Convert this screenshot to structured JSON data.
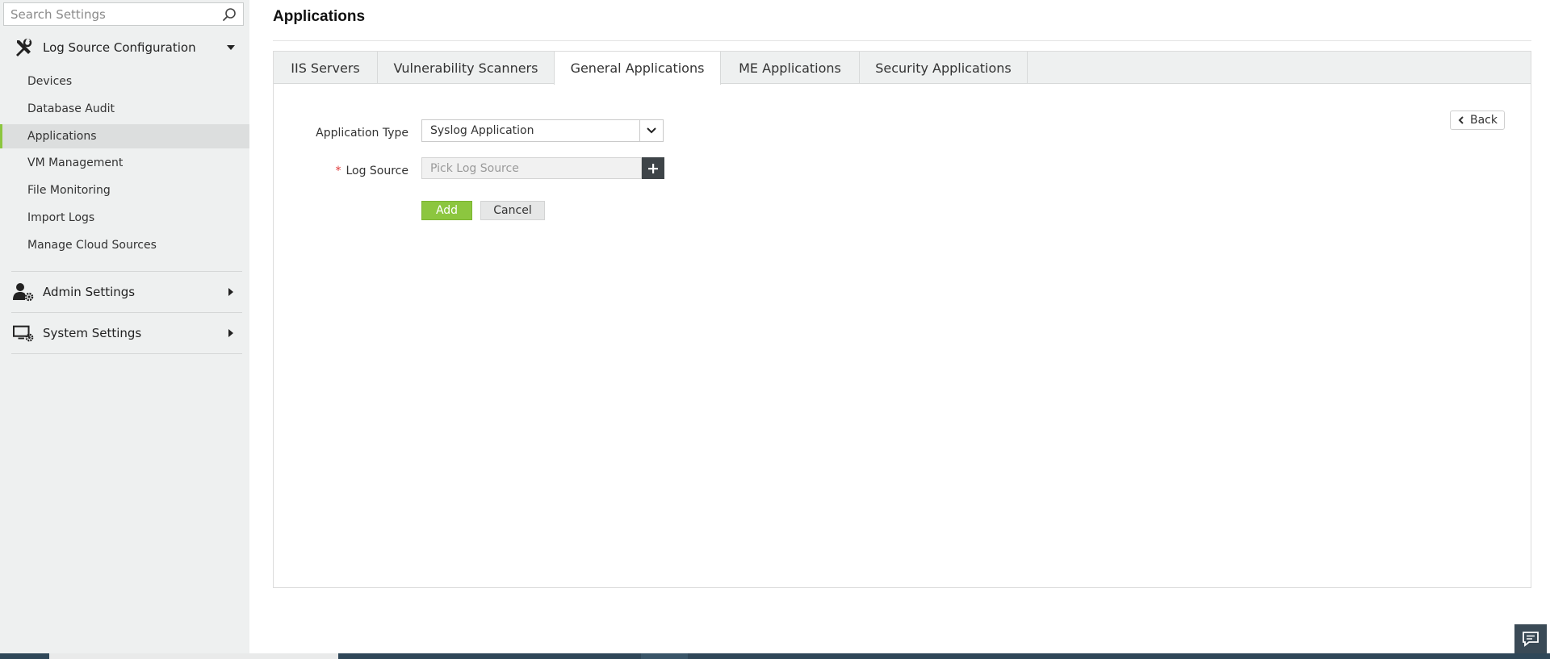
{
  "search": {
    "placeholder": "Search Settings",
    "icon": "search-icon"
  },
  "sidebar": {
    "sections": [
      {
        "label": "Log Source Configuration",
        "icon": "tools-icon",
        "expanded": true,
        "items": [
          {
            "label": "Devices",
            "active": false
          },
          {
            "label": "Database Audit",
            "active": false
          },
          {
            "label": "Applications",
            "active": true
          },
          {
            "label": "VM Management",
            "active": false
          },
          {
            "label": "File Monitoring",
            "active": false
          },
          {
            "label": "Import Logs",
            "active": false
          },
          {
            "label": "Manage Cloud Sources",
            "active": false
          }
        ]
      },
      {
        "label": "Admin Settings",
        "icon": "user-gear-icon",
        "expanded": false
      },
      {
        "label": "System Settings",
        "icon": "monitor-gear-icon",
        "expanded": false
      }
    ]
  },
  "main": {
    "title": "Applications",
    "tabs": [
      {
        "label": "IIS Servers",
        "active": false
      },
      {
        "label": "Vulnerability Scanners",
        "active": false
      },
      {
        "label": "General Applications",
        "active": true
      },
      {
        "label": "ME Applications",
        "active": false
      },
      {
        "label": "Security Applications",
        "active": false
      }
    ],
    "back_label": "Back",
    "form": {
      "application_type_label": "Application Type",
      "application_type_value": "Syslog Application",
      "log_source_required_mark": "*",
      "log_source_label": "Log Source",
      "log_source_placeholder": "Pick Log Source",
      "add_label": "Add",
      "cancel_label": "Cancel"
    }
  },
  "colors": {
    "accent_green": "#8cc63f",
    "sidebar_bg": "#eef0f0",
    "dark_button": "#3e4448",
    "required_red": "#e03a3a"
  }
}
